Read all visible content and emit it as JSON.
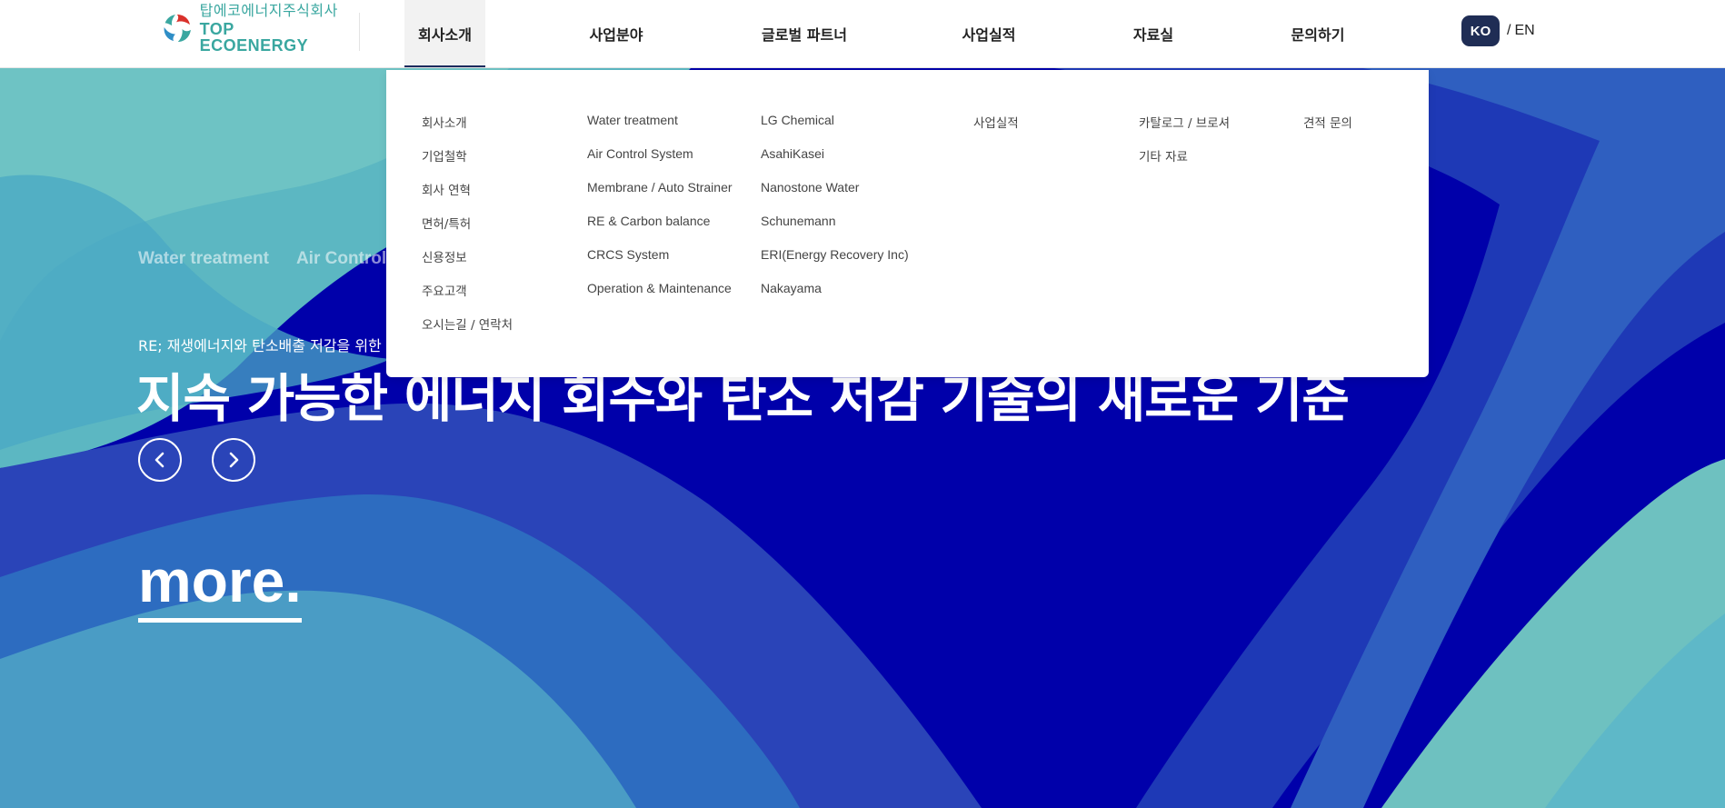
{
  "brand": {
    "name_ko": "탑에코에너지주식회사",
    "name_en": "TOP ECOENERGY",
    "logo_icon": "swirl-logo-icon"
  },
  "nav": {
    "items": [
      {
        "label": "회사소개",
        "active": true
      },
      {
        "label": "사업분야"
      },
      {
        "label": "글로벌 파트너"
      },
      {
        "label": "사업실적"
      },
      {
        "label": "자료실"
      },
      {
        "label": "문의하기"
      }
    ]
  },
  "lang": {
    "ko": "KO",
    "sep": "/",
    "en": "EN"
  },
  "menu": {
    "company": [
      "회사소개",
      "기업철학",
      "회사 연혁",
      "면허/특허",
      "신용정보",
      "주요고객",
      "오시는길 / 연락처"
    ],
    "business": [
      "Water treatment",
      "Air Control System",
      "Membrane / Auto Strainer",
      "RE & Carbon balance",
      "CRCS System",
      "Operation & Maintenance"
    ],
    "partners": [
      "LG Chemical",
      "AsahiKasei",
      "Nanostone Water",
      "Schunemann",
      "ERI(Energy Recovery Inc)",
      "Nakayama"
    ],
    "performance": [
      "사업실적"
    ],
    "resources": [
      "카탈로그 / 브로셔",
      "기타 자료"
    ],
    "contact": [
      "견적 문의"
    ]
  },
  "hero": {
    "tabs": [
      "Water treatment",
      "Air Control"
    ],
    "subtitle": "RE; 재생에너지와 탄소배출 저감을 위한",
    "headline": "지속 가능한 에너지 회수와 탄소 저감 기술의 새로운 기준",
    "more": "more.",
    "prev_icon": "chevron-left-icon",
    "next_icon": "chevron-right-icon"
  },
  "colors": {
    "brand_teal": "#3aa7a0",
    "nav_active_bar": "#1d2d5f",
    "lang_badge": "#1f2d55",
    "hero_blue": "#0000aa",
    "hero_teal": "#6fc0c0"
  }
}
